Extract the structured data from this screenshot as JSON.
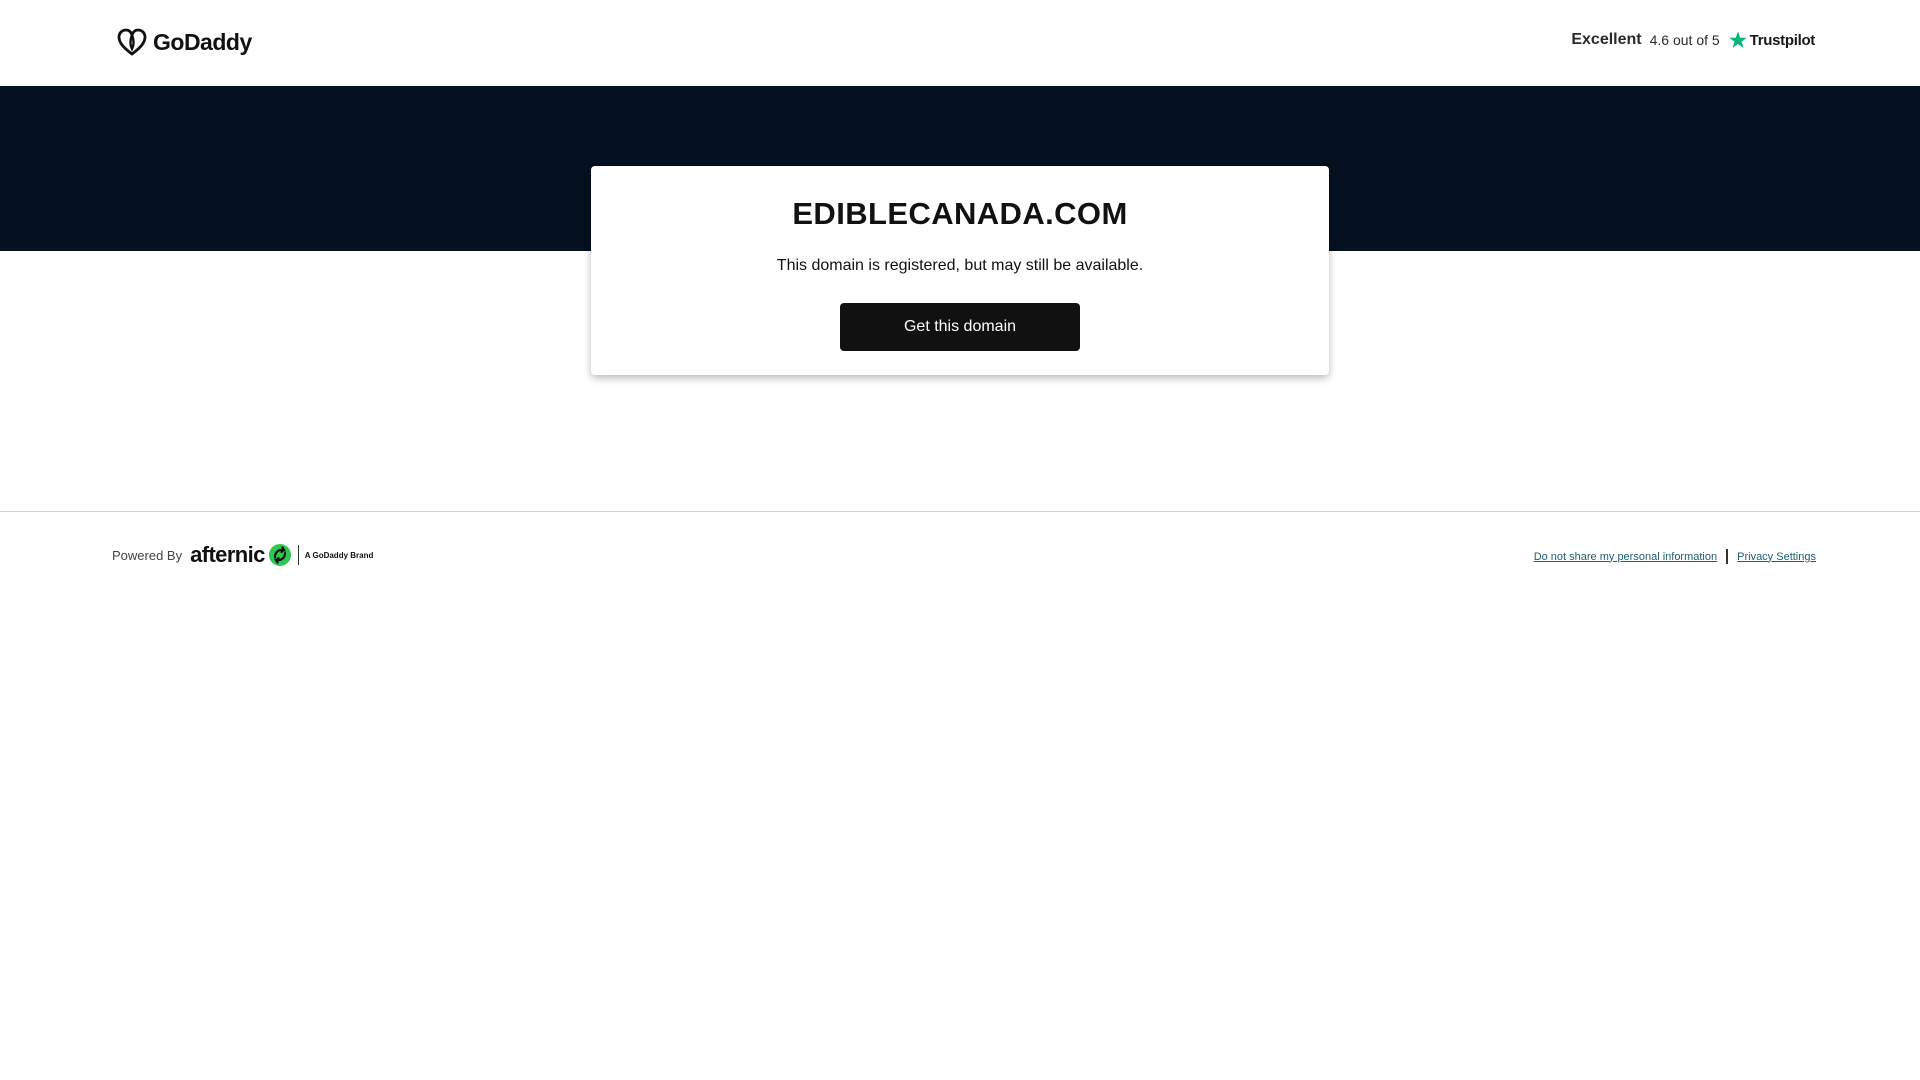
{
  "header": {
    "logo_text": "GoDaddy",
    "rating_label": "Excellent",
    "rating_score": "4.6 out of 5",
    "rating_brand": "Trustpilot"
  },
  "card": {
    "domain": "EDIBLECANADA.COM",
    "subtitle": "This domain is registered, but may still be available.",
    "cta_label": "Get this domain"
  },
  "footer": {
    "powered_by": "Powered By",
    "brand_word": "afternic",
    "brand_tag": "A GoDaddy Brand",
    "links": [
      "Do not share my personal information",
      "Privacy Settings"
    ]
  },
  "colors": {
    "hero_band": "#051020",
    "button": "#111111",
    "trustpilot_star": "#00b67a",
    "afternic_green": "#2ec650",
    "footer_link": "#1d5f6e"
  },
  "icons": {
    "logo": "godaddy-heart-icon",
    "star": "trustpilot-star-icon",
    "afternic": "afternic-arrows-icon"
  }
}
